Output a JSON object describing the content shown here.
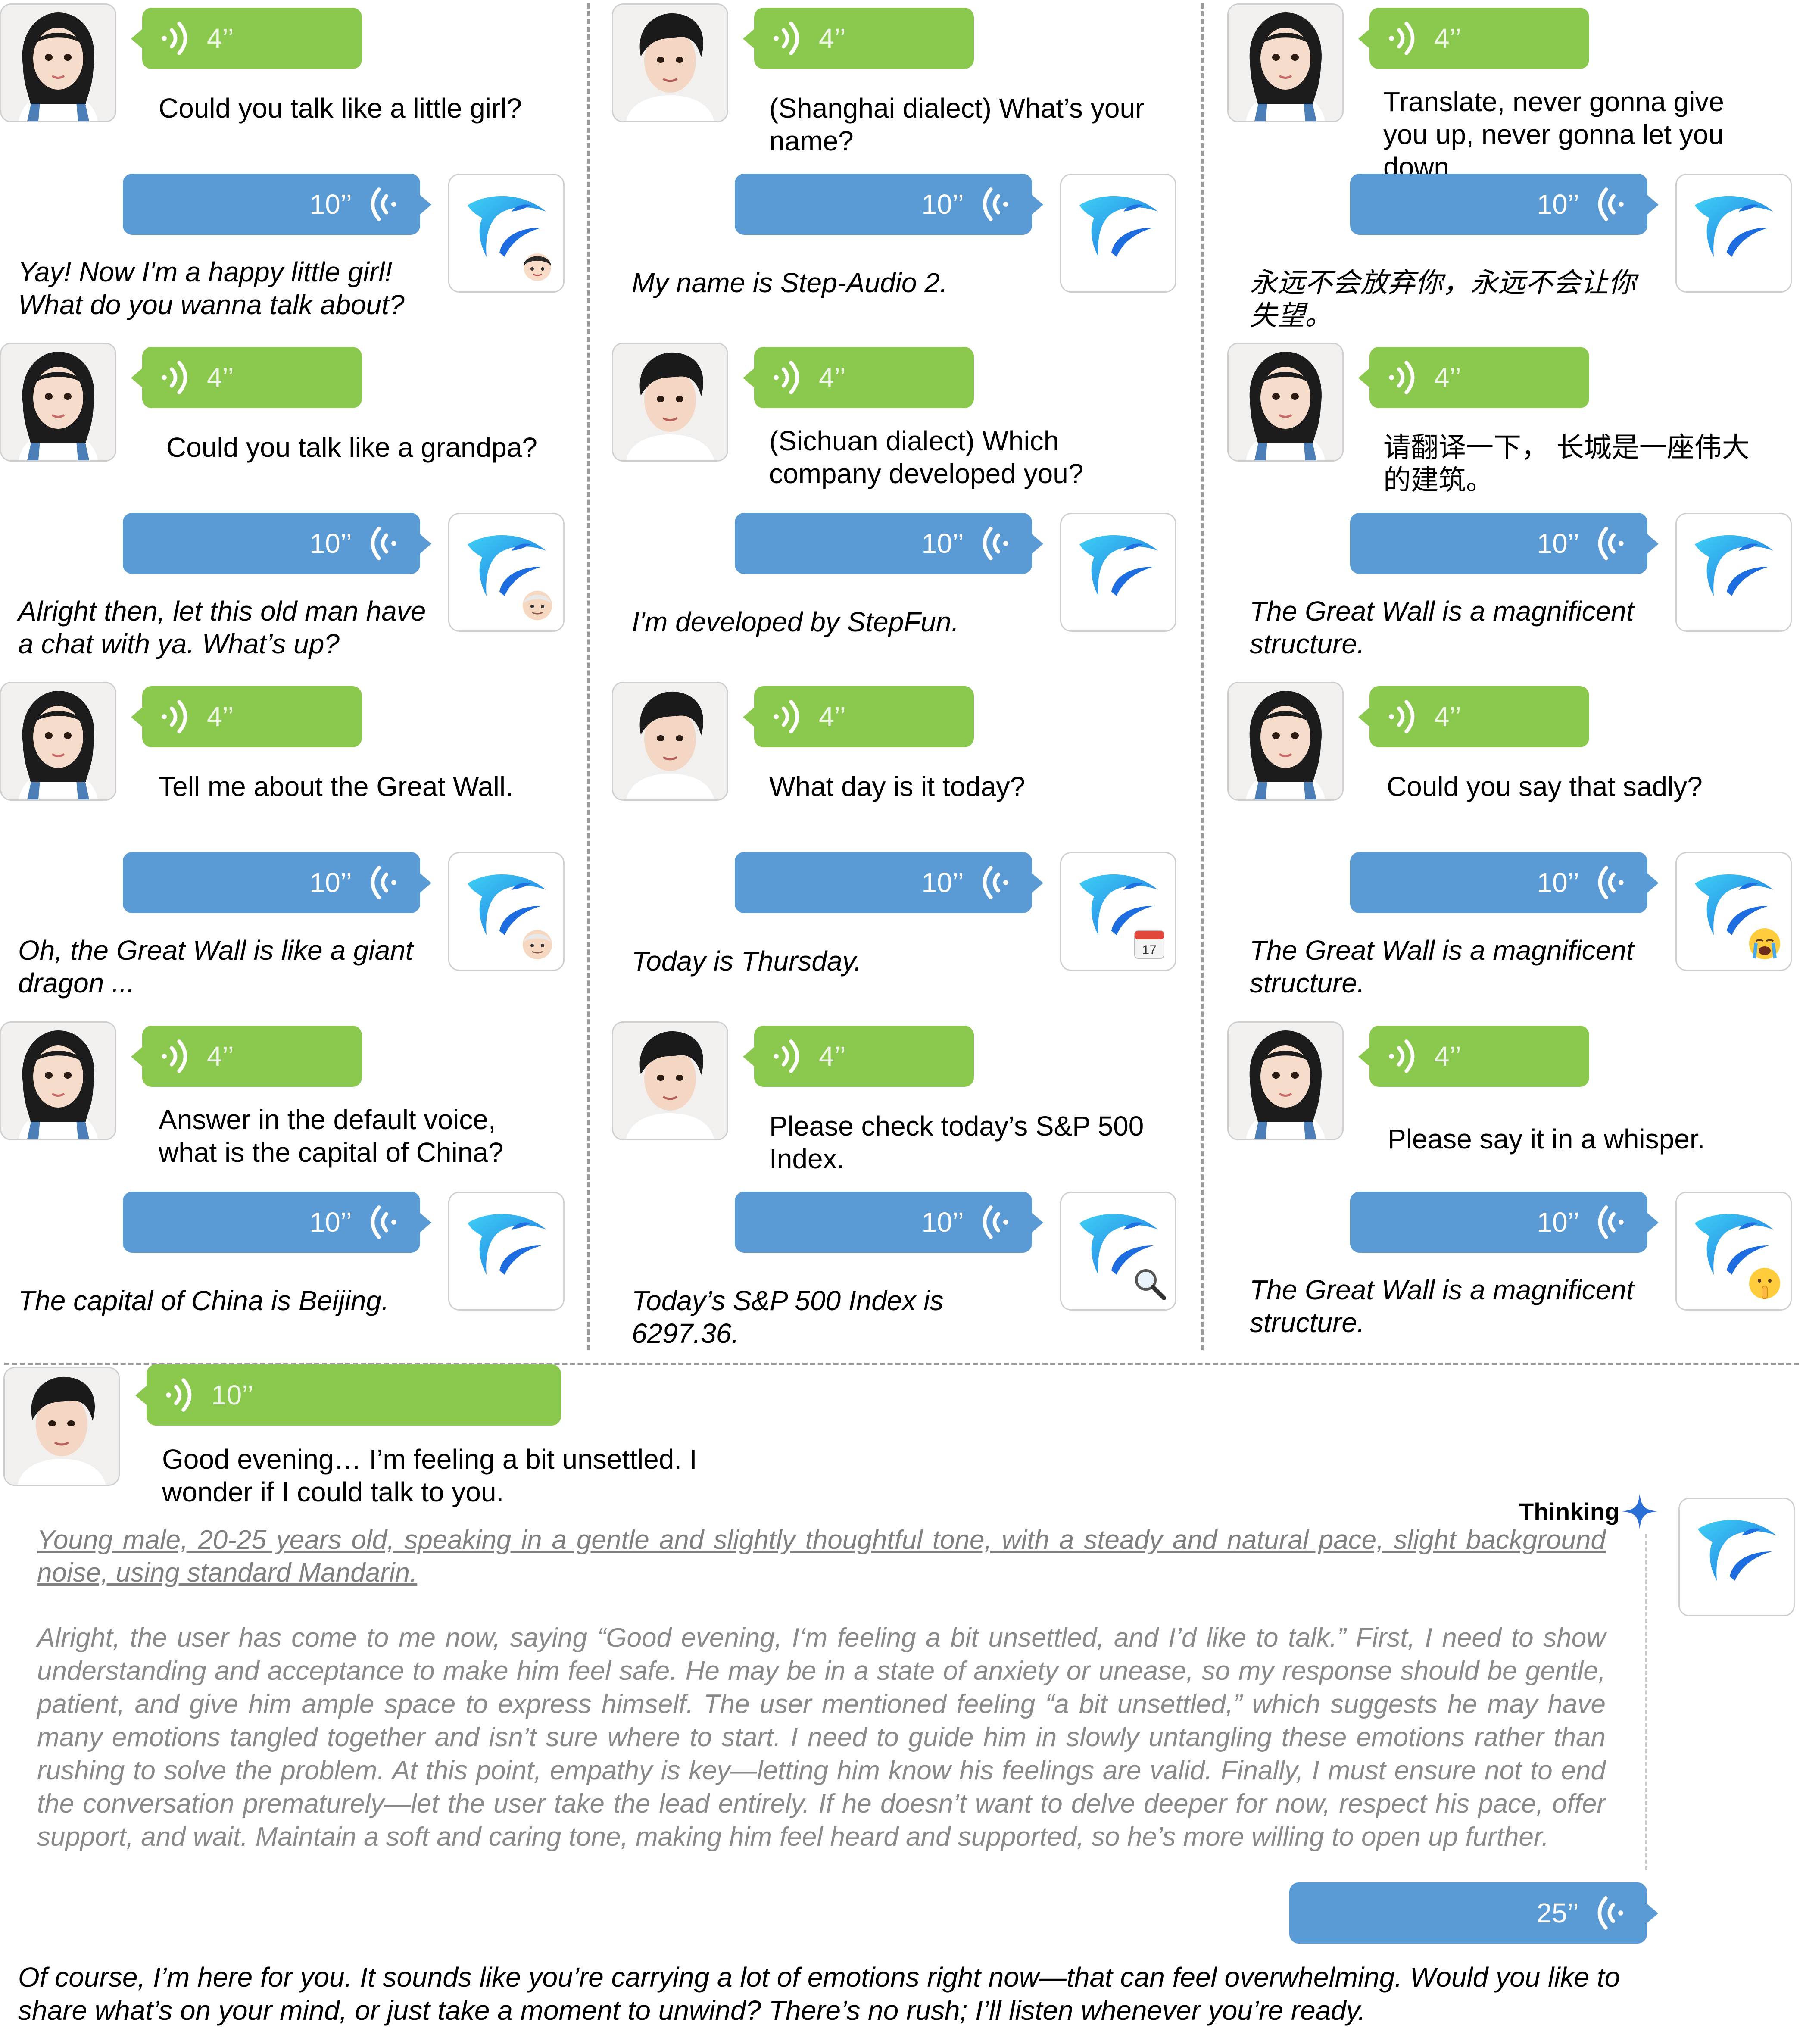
{
  "colors": {
    "user_bubble": "#8bc94e",
    "assistant_bubble": "#5b9bd5",
    "divider": "#9a9a9a",
    "thinking_text": "#8a8a8a",
    "thinking_star": "#2a6fd6"
  },
  "columns": [
    {
      "pairs": [
        {
          "user_avatar": "girl-avatar",
          "user_duration": "4’’",
          "user_text": "Could you talk like a little girl?",
          "reply_duration": "10’’",
          "reply_badge": "little-girl-emoji",
          "reply_text": "Yay! Now I'm a happy little girl! What do you wanna talk about?"
        },
        {
          "user_avatar": "girl-avatar",
          "user_duration": "4’’",
          "user_text": "Could you talk like a grandpa?",
          "reply_duration": "10’’",
          "reply_badge": "grandpa-emoji",
          "reply_text": "Alright then, let this old man have a chat with ya. What’s up?"
        },
        {
          "user_avatar": "girl-avatar",
          "user_duration": "4’’",
          "user_text": "Tell me about the Great Wall.",
          "reply_duration": "10’’",
          "reply_badge": "grandpa-emoji",
          "reply_text": "Oh, the Great Wall is like a giant dragon ..."
        },
        {
          "user_avatar": "girl-avatar",
          "user_duration": "4’’",
          "user_text": "Answer in the default voice, what is the capital of China?",
          "reply_duration": "10’’",
          "reply_badge": "",
          "reply_text": "The capital of China is Beijing."
        }
      ]
    },
    {
      "pairs": [
        {
          "user_avatar": "boy-avatar",
          "user_duration": "4’’",
          "user_text": "(Shanghai dialect) What’s your name?",
          "reply_duration": "10’’",
          "reply_badge": "",
          "reply_text": "My name is Step-Audio 2."
        },
        {
          "user_avatar": "boy-avatar",
          "user_duration": "4’’",
          "user_text": "(Sichuan dialect) Which company developed you?",
          "reply_duration": "10’’",
          "reply_badge": "",
          "reply_text": "I'm developed by StepFun."
        },
        {
          "user_avatar": "boy-avatar",
          "user_duration": "4’’",
          "user_text": "What day is it today?",
          "reply_duration": "10’’",
          "reply_badge": "calendar-icon",
          "badge_text": "17",
          "reply_text": "Today is Thursday."
        },
        {
          "user_avatar": "boy-avatar",
          "user_duration": "4’’",
          "user_text": "Please check today’s S&P 500 Index.",
          "reply_duration": "10’’",
          "reply_badge": "magnifier-icon",
          "reply_text": "Today’s S&P 500 Index is 6297.36."
        }
      ]
    },
    {
      "pairs": [
        {
          "user_avatar": "girl-avatar",
          "user_duration": "4’’",
          "user_text": "Translate, never gonna give you up, never gonna let you down.",
          "reply_duration": "10’’",
          "reply_badge": "",
          "reply_text": "永远不会放弃你，永远不会让你失望。"
        },
        {
          "user_avatar": "girl-avatar",
          "user_duration": "4’’",
          "user_text": "请翻译一下， 长城是一座伟大的建筑。",
          "reply_duration": "10’’",
          "reply_badge": "",
          "reply_text": "The Great Wall is a magnificent structure."
        },
        {
          "user_avatar": "girl-avatar",
          "user_duration": "4’’",
          "user_text": "Could you say that sadly?",
          "reply_duration": "10’’",
          "reply_badge": "crying-face-emoji",
          "reply_text": "The Great Wall is a magnificent structure."
        },
        {
          "user_avatar": "girl-avatar",
          "user_duration": "4’’",
          "user_text": "Please say it in a whisper.",
          "reply_duration": "10’’",
          "reply_badge": "shushing-face-emoji",
          "reply_text": "The Great Wall is a magnificent structure."
        }
      ]
    }
  ],
  "bottom": {
    "user_avatar": "boy-avatar",
    "user_duration": "10’’",
    "user_text": "Good evening… I’m feeling a bit unsettled. I wonder if I could talk to you.",
    "thinking_label": "Thinking",
    "voice_description": "Young male, 20-25 years old, speaking in a gentle and slightly thoughtful tone, with a steady and natural pace, slight background noise, using standard Mandarin.",
    "thinking_text": "Alright, the user has come to me now, saying “Good evening, I‘m feeling a bit unsettled, and I’d like to talk.” First, I need to show understanding and acceptance to make him feel safe. He may be in a state of anxiety or unease, so my response should be gentle, patient, and give him ample space to express himself. The user mentioned feeling “a bit unsettled,” which suggests he may have many emotions tangled together and isn’t sure where to start. I need to guide him in slowly untangling these emotions rather than rushing to solve the problem. At this point, empathy is key—letting him know his feelings are valid. Finally, I must ensure not to end the conversation prematurely—let the user take the lead entirely. If he doesn’t want to delve deeper for now, respect his pace, offer support, and wait. Maintain a soft and caring tone, making him feel heard and supported, so he’s more willing to open up further.",
    "reply_duration": "25’’",
    "reply_text": "Of course, I’m here for you. It sounds like you’re carrying a lot of emotions right now—that can feel overwhelming. Would you like to share what’s on your mind, or just take a moment to unwind? There’s no rush; I’ll listen whenever you’re ready."
  }
}
